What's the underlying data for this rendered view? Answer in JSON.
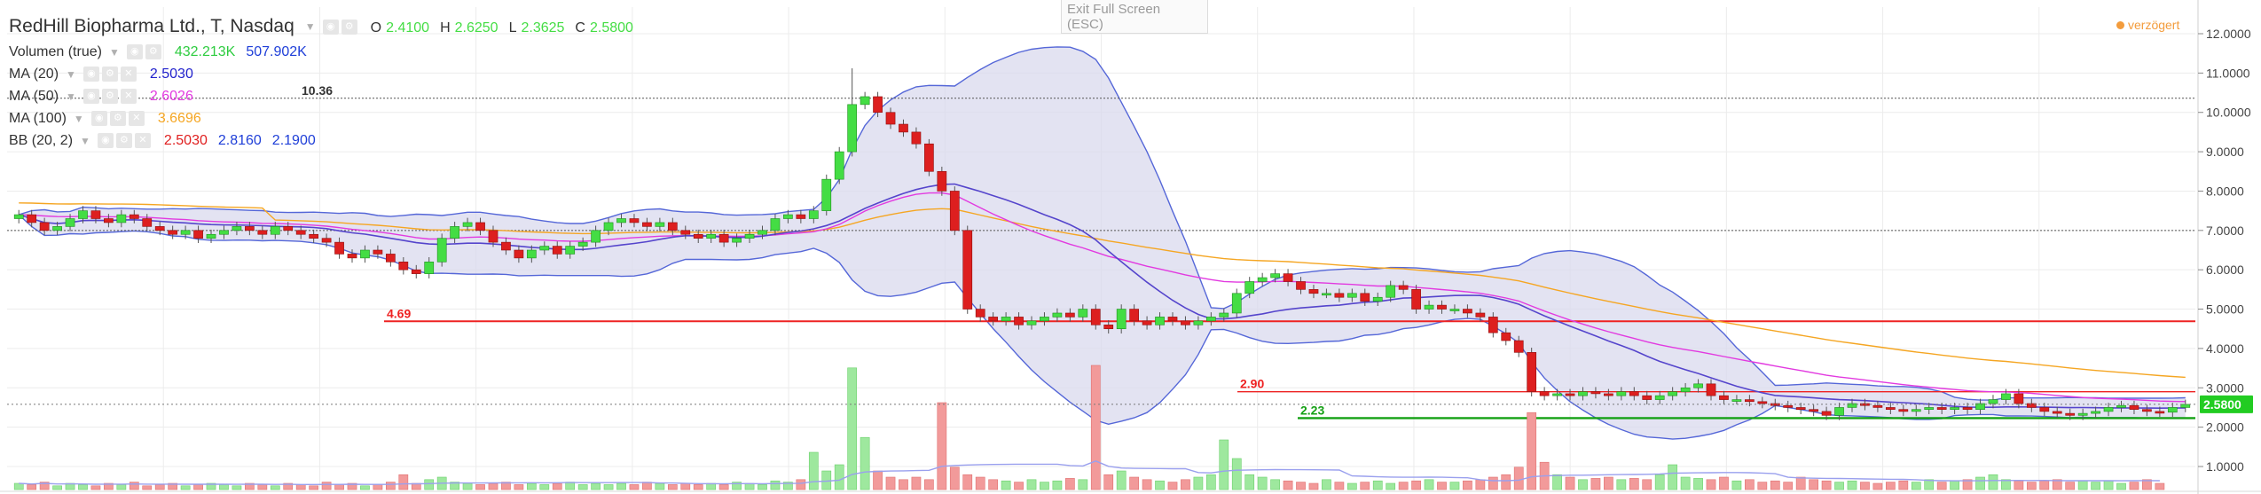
{
  "header": {
    "title": "RedHill Biopharma Ltd., T, Nasdaq",
    "ohlc": [
      {
        "label": "O",
        "value": "2.4100"
      },
      {
        "label": "H",
        "value": "2.6250"
      },
      {
        "label": "L",
        "value": "2.3625"
      },
      {
        "label": "C",
        "value": "2.5800"
      }
    ]
  },
  "indicators": [
    {
      "name": "Volumen (true)",
      "values": [
        "432.213K",
        "507.902K"
      ],
      "colors": [
        "#2ecc40",
        "#1f3fd8"
      ],
      "controls": false
    },
    {
      "name": "MA (20)",
      "values": [
        "2.5030"
      ],
      "colors": [
        "#2222cc"
      ],
      "controls": true
    },
    {
      "name": "MA (50)",
      "values": [
        "2.6026"
      ],
      "colors": [
        "#e23ae0"
      ],
      "controls": true
    },
    {
      "name": "MA (100)",
      "values": [
        "3.6696"
      ],
      "colors": [
        "#f5a623"
      ],
      "controls": true
    },
    {
      "name": "BB (20, 2)",
      "values": [
        "2.5030",
        "2.8160",
        "2.1900"
      ],
      "colors": [
        "#e02020",
        "#1f3fd8",
        "#1f3fd8"
      ],
      "controls": true
    }
  ],
  "exit_fullscreen": {
    "line1": "Exit Full Screen",
    "line2": "(ESC)"
  },
  "delayed_label": "verzögert",
  "colors": {
    "up": "#44dd44",
    "down": "#dd1f1f",
    "bb_band": "#5567d8",
    "bb_fill": "#d9d9ee",
    "ma20": "#5545cc",
    "ma50": "#e23ae0",
    "ma100": "#f5a623",
    "level_red": "#ee2222",
    "level_green": "#14a014",
    "current_price_bg": "#22cc22"
  },
  "chart_data": {
    "type": "candlestick",
    "title": "RedHill Biopharma Ltd., T, Nasdaq",
    "y_axis": {
      "range": [
        0.6,
        12.6
      ],
      "ticks": [
        1.0,
        2.0,
        3.0,
        4.0,
        5.0,
        6.0,
        7.0,
        8.0,
        9.0,
        10.0,
        11.0,
        12.0
      ],
      "tick_labels": [
        "1.0000",
        "2.0000",
        "3.0000",
        "4.0000",
        "5.0000",
        "6.0000",
        "7.0000",
        "8.0000",
        "9.0000",
        "10.0000",
        "11.0000",
        "12.0000"
      ],
      "side": "right"
    },
    "grid": true,
    "horizontal_levels": [
      {
        "value": 10.36,
        "label": "10.36",
        "style": "dotted"
      },
      {
        "value": 7.0,
        "label": "",
        "style": "dotted"
      },
      {
        "value": 4.69,
        "label": "4.69",
        "style": "solid-red"
      },
      {
        "value": 2.9,
        "label": "2.90",
        "style": "solid-red-thin"
      },
      {
        "value": 2.23,
        "label": "2.23",
        "style": "solid-green"
      }
    ],
    "current_price": {
      "value": 2.58,
      "label": "2.5800"
    },
    "closes": [
      7.4,
      7.2,
      7.0,
      7.1,
      7.3,
      7.5,
      7.3,
      7.2,
      7.4,
      7.3,
      7.1,
      7.0,
      6.9,
      7.0,
      6.8,
      6.9,
      7.0,
      7.1,
      7.0,
      6.9,
      7.1,
      7.0,
      6.9,
      6.8,
      6.7,
      6.4,
      6.3,
      6.5,
      6.4,
      6.2,
      6.0,
      5.9,
      6.2,
      6.8,
      7.1,
      7.2,
      7.0,
      6.7,
      6.5,
      6.3,
      6.5,
      6.6,
      6.4,
      6.6,
      6.7,
      7.0,
      7.2,
      7.3,
      7.2,
      7.1,
      7.2,
      7.0,
      6.9,
      6.8,
      6.9,
      6.7,
      6.8,
      6.9,
      7.0,
      7.3,
      7.4,
      7.3,
      7.5,
      8.3,
      9.0,
      10.2,
      10.4,
      10.0,
      9.7,
      9.5,
      9.2,
      8.5,
      8.0,
      7.0,
      5.0,
      4.8,
      4.7,
      4.8,
      4.6,
      4.7,
      4.8,
      4.9,
      4.8,
      5.0,
      4.6,
      4.5,
      5.0,
      4.7,
      4.6,
      4.8,
      4.7,
      4.6,
      4.7,
      4.8,
      4.9,
      5.4,
      5.7,
      5.8,
      5.9,
      5.7,
      5.5,
      5.4,
      5.4,
      5.3,
      5.4,
      5.2,
      5.3,
      5.6,
      5.5,
      5.0,
      5.1,
      5.0,
      5.0,
      4.9,
      4.8,
      4.4,
      4.2,
      3.9,
      2.9,
      2.8,
      2.85,
      2.8,
      2.9,
      2.85,
      2.8,
      2.9,
      2.8,
      2.7,
      2.8,
      2.9,
      3.0,
      3.1,
      2.8,
      2.7,
      2.7,
      2.65,
      2.6,
      2.55,
      2.5,
      2.45,
      2.4,
      2.3,
      2.5,
      2.6,
      2.55,
      2.5,
      2.45,
      2.4,
      2.45,
      2.5,
      2.45,
      2.5,
      2.45,
      2.6,
      2.7,
      2.85,
      2.6,
      2.5,
      2.4,
      2.35,
      2.3,
      2.35,
      2.4,
      2.5,
      2.55,
      2.45,
      2.4,
      2.38,
      2.5,
      2.58
    ],
    "volume": [
      0.05,
      0.04,
      0.06,
      0.03,
      0.05,
      0.04,
      0.03,
      0.05,
      0.04,
      0.06,
      0.03,
      0.04,
      0.05,
      0.03,
      0.04,
      0.05,
      0.04,
      0.03,
      0.05,
      0.04,
      0.03,
      0.05,
      0.04,
      0.03,
      0.06,
      0.04,
      0.05,
      0.03,
      0.04,
      0.06,
      0.12,
      0.05,
      0.08,
      0.1,
      0.06,
      0.05,
      0.04,
      0.05,
      0.06,
      0.04,
      0.05,
      0.04,
      0.05,
      0.06,
      0.04,
      0.05,
      0.04,
      0.05,
      0.04,
      0.06,
      0.05,
      0.04,
      0.05,
      0.04,
      0.05,
      0.04,
      0.06,
      0.05,
      0.04,
      0.07,
      0.06,
      0.08,
      0.3,
      0.15,
      0.2,
      0.98,
      0.42,
      0.15,
      0.1,
      0.08,
      0.1,
      0.08,
      0.7,
      0.18,
      0.12,
      0.1,
      0.08,
      0.07,
      0.06,
      0.08,
      0.06,
      0.07,
      0.09,
      0.08,
      1.0,
      0.12,
      0.15,
      0.1,
      0.08,
      0.07,
      0.06,
      0.08,
      0.1,
      0.12,
      0.4,
      0.25,
      0.12,
      0.1,
      0.08,
      0.07,
      0.06,
      0.05,
      0.08,
      0.06,
      0.05,
      0.06,
      0.07,
      0.05,
      0.06,
      0.07,
      0.08,
      0.06,
      0.06,
      0.07,
      0.08,
      0.1,
      0.12,
      0.18,
      0.62,
      0.22,
      0.12,
      0.1,
      0.08,
      0.09,
      0.1,
      0.08,
      0.09,
      0.08,
      0.12,
      0.2,
      0.1,
      0.09,
      0.08,
      0.1,
      0.07,
      0.08,
      0.06,
      0.07,
      0.06,
      0.1,
      0.08,
      0.07,
      0.06,
      0.07,
      0.06,
      0.05,
      0.06,
      0.07,
      0.06,
      0.08,
      0.06,
      0.07,
      0.08,
      0.1,
      0.12,
      0.08,
      0.07,
      0.06,
      0.07,
      0.08,
      0.06,
      0.07,
      0.06,
      0.07,
      0.05,
      0.06,
      0.08,
      0.05
    ]
  }
}
